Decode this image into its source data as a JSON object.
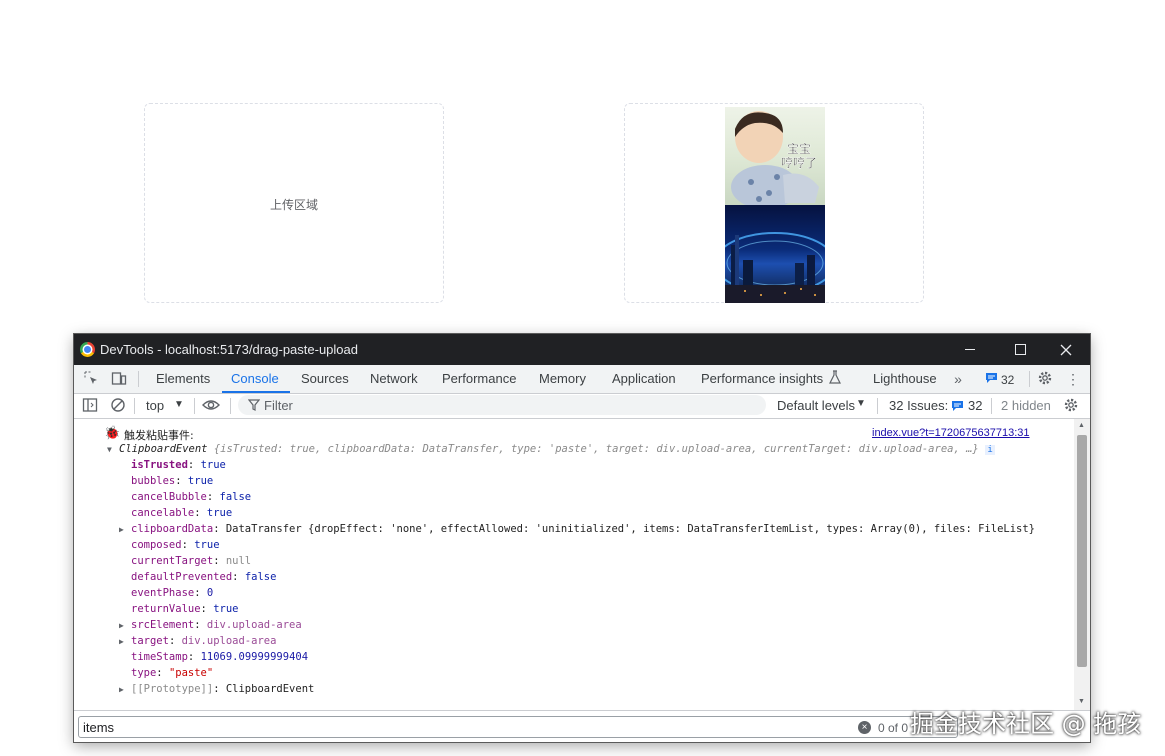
{
  "upload": {
    "left_hint": "上传区域",
    "preview_text": "宝宝\n哼哼了"
  },
  "devtools": {
    "title": "DevTools - localhost:5173/drag-paste-upload",
    "tabs": [
      "Elements",
      "Console",
      "Sources",
      "Network",
      "Performance",
      "Memory",
      "Application",
      "Performance insights",
      "Lighthouse"
    ],
    "issues_badge": "32",
    "toolbar": {
      "context": "top",
      "filter_placeholder": "Filter",
      "levels": "Default levels",
      "issues_label": "32 Issues:",
      "issues_count": "32",
      "hidden": "2 hidden"
    },
    "console": {
      "log_label": "触发粘贴事件:",
      "source_link": "index.vue?t=1720675637713:31",
      "summary_class": "ClipboardEvent",
      "summary_body": "{isTrusted: true, clipboardData: DataTransfer, type: 'paste', target: div.upload-area, currentTarget: div.upload-area, …}",
      "props": [
        {
          "key": "isTrusted",
          "value": "true"
        },
        {
          "key": "bubbles",
          "value": "true"
        },
        {
          "key": "cancelBubble",
          "value": "false"
        },
        {
          "key": "cancelable",
          "value": "true"
        },
        {
          "key": "clipboardData",
          "value": "DataTransfer {dropEffect: 'none', effectAllowed: 'uninitialized', items: DataTransferItemList, types: Array(0), files: FileList}"
        },
        {
          "key": "composed",
          "value": "true"
        },
        {
          "key": "currentTarget",
          "value": "null"
        },
        {
          "key": "defaultPrevented",
          "value": "false"
        },
        {
          "key": "eventPhase",
          "value": "0"
        },
        {
          "key": "returnValue",
          "value": "true"
        },
        {
          "key": "srcElement",
          "value": "div.upload-area"
        },
        {
          "key": "target",
          "value": "div.upload-area"
        },
        {
          "key": "timeStamp",
          "value": "11069.09999999404"
        },
        {
          "key": "type",
          "value": "\"paste\""
        },
        {
          "key": "[[Prototype]]",
          "value": "ClipboardEvent"
        }
      ]
    },
    "search": {
      "value": "items",
      "match_count": "0 of 0"
    }
  },
  "watermark": "掘金技术社区 @ 拖孩"
}
